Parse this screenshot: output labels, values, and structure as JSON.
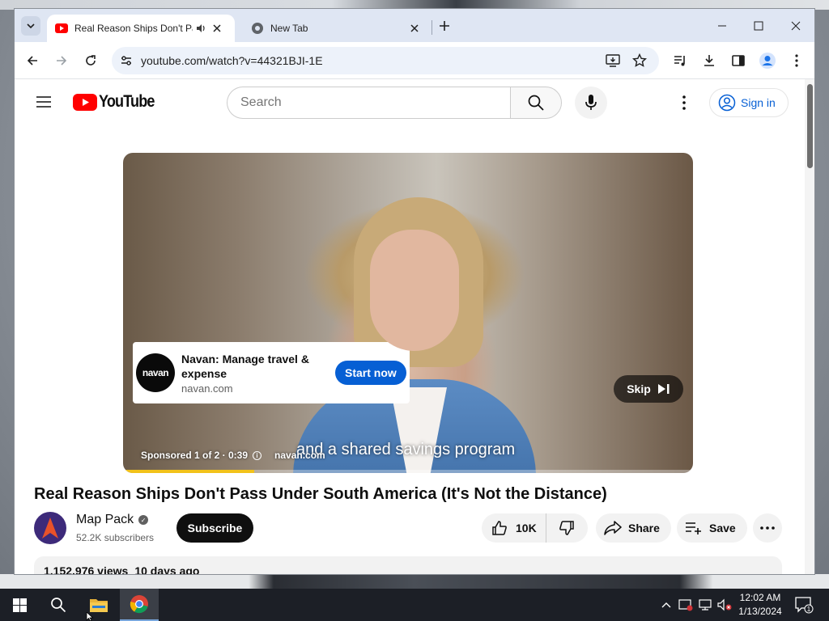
{
  "browser": {
    "tabs": [
      {
        "title": "Real Reason Ships Don't Pa",
        "active": true,
        "audio": true
      },
      {
        "title": "New Tab",
        "active": false
      }
    ],
    "url": "youtube.com/watch?v=44321BJI-1E"
  },
  "youtube": {
    "logo_text": "YouTube",
    "search_placeholder": "Search",
    "sign_in": "Sign in",
    "ad": {
      "advertiser_logo_text": "navan",
      "title": "Navan: Manage travel & expense",
      "url": "navan.com",
      "cta": "Start now",
      "skip": "Skip",
      "sponsored": "Sponsored 1 of 2 · 0:39",
      "domain": "navan.com",
      "caption": "and a shared savings program",
      "progress_percent": 23
    },
    "video": {
      "title": "Real Reason Ships Don't Pass Under South America (It's Not the Distance)",
      "channel": "Map Pack",
      "subscribers": "52.2K subscribers",
      "subscribe": "Subscribe",
      "likes": "10K",
      "share": "Share",
      "save": "Save",
      "views": "1,152,976 views",
      "uploaded": "10 days ago"
    }
  },
  "taskbar": {
    "time": "12:02 AM",
    "date": "1/13/2024",
    "notifications": "1"
  },
  "colors": {
    "youtube_red": "#ff0000",
    "link_blue": "#065fd4",
    "ad_progress": "#f2c21a",
    "taskbar": "#1c1f26"
  }
}
